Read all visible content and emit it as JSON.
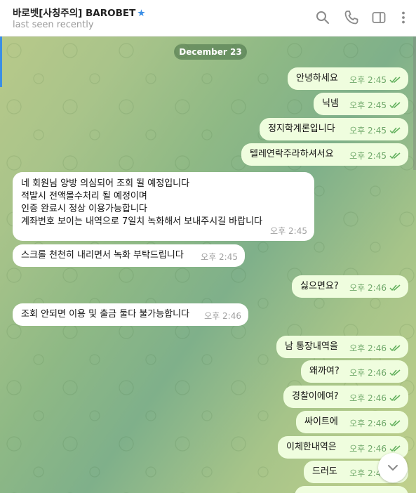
{
  "header": {
    "title": "바로벳[사칭주의] BAROBET",
    "subtitle": "last seen recently"
  },
  "chat": {
    "date_label": "December 23",
    "messages": [
      {
        "text": "안녕하세요",
        "time": "오후 2:45",
        "dir": "out"
      },
      {
        "text": "닉넴",
        "time": "오후 2:45",
        "dir": "out"
      },
      {
        "text": "정지학계론입니다",
        "time": "오후 2:45",
        "dir": "out"
      },
      {
        "text": "텔레연락주라하셔서요",
        "time": "오후 2:45",
        "dir": "out"
      },
      {
        "lines": [
          "네 회원님 양방 의심되어 조회 될 예정입니다",
          "적발시 전액몰수처리 될 예정이며",
          "인증 완료시 정상 이용가능합니다",
          "계좌번호 보이는 내역으로 7일치 녹화해서 보내주시길 바랍니다"
        ],
        "time": "오후 2:45",
        "dir": "in"
      },
      {
        "text": "스크롤 천천히 내리면서 녹화 부탁드립니다",
        "time": "오후 2:45",
        "dir": "in"
      },
      {
        "text": "싫으면요?",
        "time": "오후 2:46",
        "dir": "out"
      },
      {
        "text": "조회 안되면 이용 및 출금 둘다 불가능합니다",
        "time": "오후 2:46",
        "dir": "in"
      },
      {
        "text": "남 통장내역을",
        "time": "오후 2:46",
        "dir": "out"
      },
      {
        "text": "왜까여?",
        "time": "오후 2:46",
        "dir": "out"
      },
      {
        "text": "경찰이에여?",
        "time": "오후 2:46",
        "dir": "out"
      },
      {
        "text": "싸이트에",
        "time": "오후 2:46",
        "dir": "out"
      },
      {
        "text": "이체한내역은",
        "time": "오후 2:46",
        "dir": "out"
      },
      {
        "text": "드러도",
        "time": "오후 2:46",
        "dir": "out"
      }
    ]
  },
  "icons": {
    "search": "search-icon",
    "call": "phone-icon",
    "sidebar": "sidebar-toggle-icon",
    "more": "more-vertical-icon",
    "verified": "star-icon",
    "read": "double-check-icon",
    "scroll": "chevron-down-icon"
  },
  "colors": {
    "accent": "#3a8ee6",
    "outgoing_bubble": "#effdde",
    "incoming_bubble": "#ffffff",
    "check": "#5fae5a"
  }
}
